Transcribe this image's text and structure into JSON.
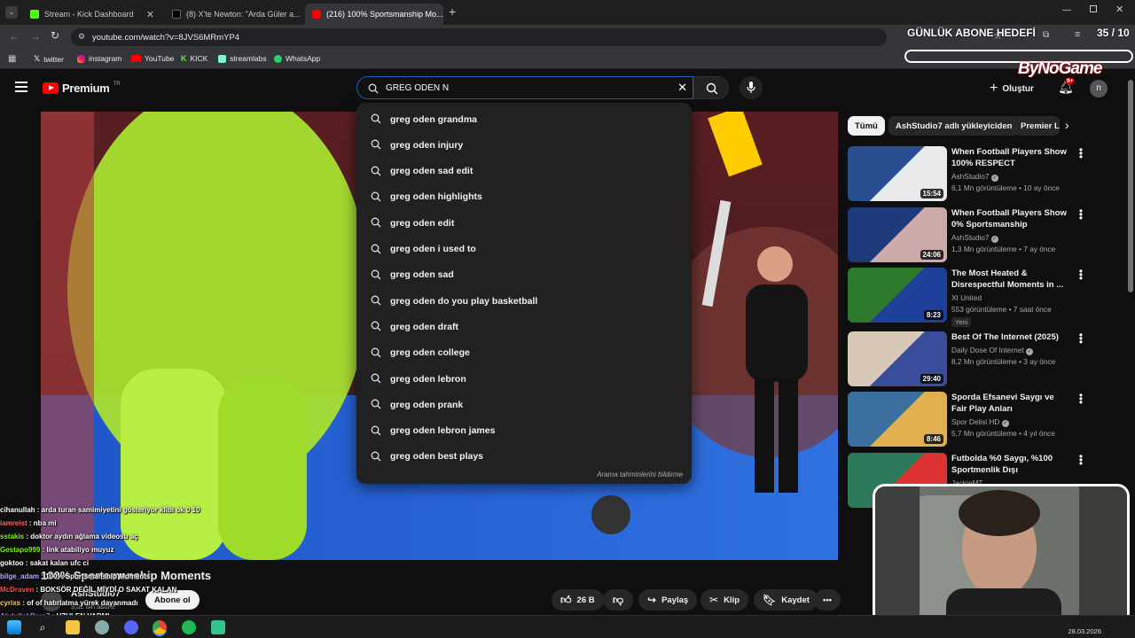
{
  "browser": {
    "tabs": [
      {
        "label": "Stream - Kick Dashboard",
        "icon": "kick-icon",
        "color": "#53fc18"
      },
      {
        "label": "(8) X'te Newton: \"Arda Güler a...",
        "icon": "x-icon",
        "color": "#000000"
      },
      {
        "label": "(216) 100% Sportsmanship Mo...",
        "icon": "youtube-icon",
        "color": "#ff0000"
      }
    ],
    "url": "youtube.com/watch?v=8JVS6MRmYP4",
    "bookmarks": [
      {
        "label": "twitter",
        "icon": "x-icon"
      },
      {
        "label": "instagram",
        "icon": "instagram-icon"
      },
      {
        "label": "YouTube",
        "icon": "youtube-icon"
      },
      {
        "label": "KICK",
        "icon": "kick-icon"
      },
      {
        "label": "streamlabs",
        "icon": "streamlabs-icon"
      },
      {
        "label": "WhatsApp",
        "icon": "whatsapp-icon"
      }
    ]
  },
  "overlay": {
    "goal_label": "GÜNLÜK ABONE HEDEFİ",
    "goal_count": "35 / 10",
    "sponsor": "ByNoGame"
  },
  "youtube": {
    "logo": "Premium",
    "logo_sup": "TR",
    "search_value": "GREG ODEN N",
    "create_label": "Oluştur",
    "notif_count": "9+",
    "avatar_letter": "n",
    "suggestions": [
      "greg oden grandma",
      "greg oden injury",
      "greg oden sad edit",
      "greg oden highlights",
      "greg oden edit",
      "greg oden i used to",
      "greg oden sad",
      "greg oden do you play basketball",
      "greg oden draft",
      "greg oden college",
      "greg oden lebron",
      "greg oden prank",
      "greg oden lebron james",
      "greg oden best plays"
    ],
    "suggest_footer": "Arama tahminlerini bildirme",
    "chips": [
      "Tümü",
      "AshStudio7 adlı yükleyiciden",
      "Premier L"
    ],
    "video_title": "100% Sportsmanship Moments",
    "channel": "AshStudio7",
    "subs": "9,02 Mn abone",
    "subscribe": "Abone ol",
    "likes": "26 B",
    "share": "Paylaş",
    "clip": "Klip",
    "save": "Kaydet",
    "recs": [
      {
        "title": "When Football Players Show 100% RESPECT",
        "channel": "AshStudio7",
        "verified": true,
        "meta": "6,1 Mn görüntüleme • 10 ay önce",
        "dur": "15:54",
        "badge": ""
      },
      {
        "title": "When Football Players Show 0% Sportsmanship",
        "channel": "AshStudio7",
        "verified": true,
        "meta": "1,3 Mn görüntüleme • 7 ay önce",
        "dur": "24:06",
        "badge": ""
      },
      {
        "title": "The Most Heated & Disrespectful Moments in ...",
        "channel": "XI United",
        "verified": false,
        "meta": "553 görüntüleme • 7 saat önce",
        "dur": "8:23",
        "badge": "Yeni"
      },
      {
        "title": "Best Of The Internet (2025)",
        "channel": "Daily Dose Of Internet",
        "verified": true,
        "meta": "8,2 Mn görüntüleme • 3 ay önce",
        "dur": "29:40",
        "badge": ""
      },
      {
        "title": "Sporda Efsanevi Saygı ve Fair Play Anları",
        "channel": "Spor Delisi HD",
        "verified": true,
        "meta": "5,7 Mn görüntüleme • 4 yıl önce",
        "dur": "8:46",
        "badge": ""
      },
      {
        "title": "Futbolda %0 Saygı, %100 Sportmenlik Dışı",
        "channel": "JackieMT",
        "verified": false,
        "meta": "",
        "dur": "",
        "badge": ""
      }
    ]
  },
  "chat": [
    {
      "user": "cihanullah",
      "color": "#ffffff",
      "msg": "arda turan samimiyetini gösteriyor klibi ok 0 10"
    },
    {
      "user": "iamreist",
      "color": "#ff6b6b",
      "msg": "nba mi"
    },
    {
      "user": "sstakis",
      "color": "#7cfc00",
      "msg": "doktor aydın ağlama videosu aç"
    },
    {
      "user": "Gestapo999",
      "color": "#7cfc00",
      "msg": "link atabiliyo muyuz"
    },
    {
      "user": "goktoo",
      "color": "#ffffff",
      "msg": "sakat kalan ufc ci"
    },
    {
      "user": "bilge_adam",
      "color": "#b0b0ff",
      "msg": "100% Sportsmanship Moments"
    },
    {
      "user": "McDraven",
      "color": "#ff4d4d",
      "msg": "BOKSÖR DEĞİL MİYDİ O SAKAT KALAN"
    },
    {
      "user": "cyrixs",
      "color": "#ffd24d",
      "msg": "of of hatırlatma yürek dayanmadı"
    },
    {
      "user": "AbdullahBera7",
      "color": "#b07cff",
      "msg": "UZULEN VARMI"
    }
  ],
  "taskbar": {
    "date": "28.03.2026"
  }
}
